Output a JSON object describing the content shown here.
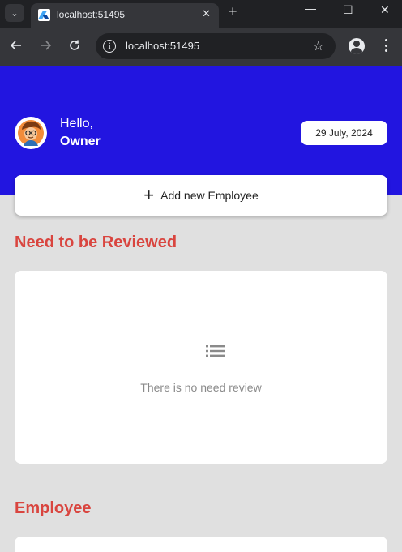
{
  "browser": {
    "tab_title": "localhost:51495",
    "url": "localhost:51495",
    "icons": {
      "tab_menu": "chevron-down-icon",
      "close_tab": "close-icon",
      "new_tab": "plus-icon",
      "back": "arrow-left-icon",
      "forward": "arrow-right-icon",
      "reload": "reload-icon",
      "site_info": "info-icon",
      "bookmark": "star-icon",
      "profile": "profile-icon",
      "menu": "kebab-menu-icon"
    }
  },
  "header": {
    "hello": "Hello,",
    "name": "Owner",
    "date": "29 July, 2024"
  },
  "add_employee": {
    "label": "Add new Employee",
    "icon": "plus-icon"
  },
  "review_section": {
    "title": "Need to be Reviewed",
    "empty_icon": "list-icon",
    "empty_message": "There is no need review"
  },
  "employee_section": {
    "title": "Employee"
  },
  "colors": {
    "header_bg": "#2215e0",
    "accent_title": "#d9453f",
    "page_bg": "#e0e0e0",
    "chrome_dark": "#202124",
    "chrome_toolbar": "#35363a"
  }
}
